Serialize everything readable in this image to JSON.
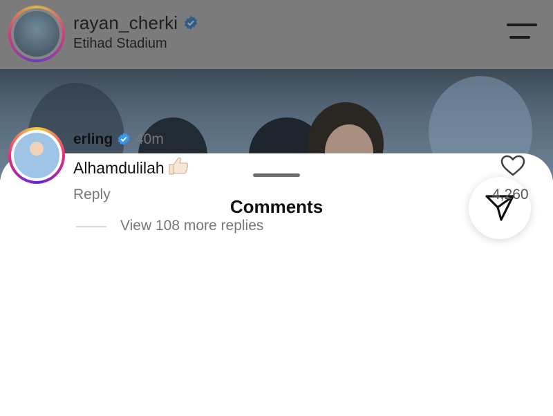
{
  "header": {
    "username": "rayan_cherki",
    "location": "Etihad Stadium"
  },
  "sheet": {
    "title": "Comments"
  },
  "comment": {
    "username": "erling",
    "time": "40m",
    "text": "Alhamdulilah",
    "reply_label": "Reply",
    "like_count": "4,260",
    "view_replies": "View 108 more replies"
  },
  "colors": {
    "verified": "#3897f0",
    "overlay": "#7b7b7b",
    "text_primary": "#111111",
    "text_secondary": "#777777"
  }
}
